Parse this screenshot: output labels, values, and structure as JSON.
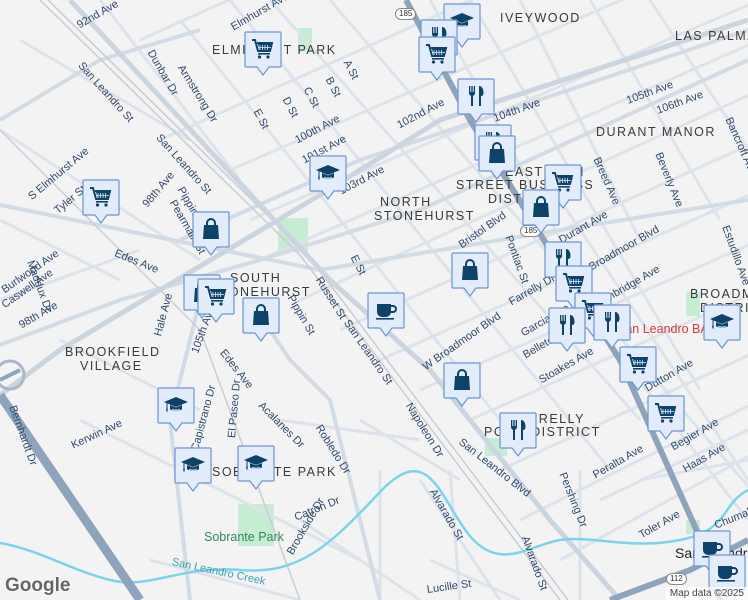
{
  "districts": {
    "elmhurst_park": "ELMHURST PARK",
    "iveywood": "IVEYWOOD",
    "las_palmas": "LAS PALMAS",
    "durant_manor": "DURANT MANOR",
    "north_stonehurst_1": "NORTH",
    "north_stonehurst_2": "STONEHURST",
    "east14_1": "EAST 14TH",
    "east14_2": "STREET BUSINESS",
    "east14_3": "DISTRICT",
    "south_stonehurst_1": "SOUTH",
    "south_stonehurst_2": "STONEHURST",
    "brookfield_1": "BROOKFIELD",
    "brookfield_2": "VILLAGE",
    "broadmoor_1": "BROADMOOR",
    "broadmoor_2": "DISTRICT",
    "farrelly_1": "FARRELLY",
    "farrelly_2": "POND DISTRICT",
    "sobrante": "SOBRANTE PARK",
    "san_leandro": "San Leandro"
  },
  "streets": {
    "s92nd": "92nd Ave",
    "elmhurst": "Elmhurst Ave",
    "dunbar": "Dunbar Dr",
    "armstrong": "Armstrong Dr",
    "ast": "A St",
    "bst": "B St",
    "cst": "C St",
    "dst": "D St",
    "est": "E St",
    "est2": "E St",
    "sls1": "San Leandro St",
    "sls2": "San Leandro St",
    "sls3": "San Leandro St",
    "a100": "100th Ave",
    "a101": "101st Ave",
    "a103": "103rd Ave",
    "a102": "102nd Ave",
    "a104": "104th Ave",
    "a105": "105th Ave",
    "a106": "106th Ave",
    "a105b": "105th Ave",
    "selmhurst": "S Elmhurst Ave",
    "tyler": "Tyler St",
    "a98": "98th Ave",
    "a98b": "98th Ave",
    "pippin": "Pippin St",
    "pippin2": "Pippin St",
    "pearmain": "Pearmain St",
    "edes": "Edes Ave",
    "edes2": "Edes Ave",
    "maddux": "Maddux Dr",
    "caswell": "Caswell Ave",
    "burlwood": "Burlwood Ave",
    "hale": "Hale Ave",
    "russet": "Russet St",
    "breed": "Breed Ave",
    "beverly": "Beverly Ave",
    "bancroft": "Bancroft Ave",
    "bristol": "Bristol Blvd",
    "pontiac": "Pontiac St",
    "durant": "Durant Ave",
    "broadmoor": "Broadmoor Blvd",
    "wbroadmoor": "W Broadmoor Blvd",
    "farrelly": "Farrelly Dr",
    "garcia": "Garcia Ave",
    "belleterre": "Belleterre Ave",
    "stoakes": "Stoakes Ave",
    "dutton": "Dutton Ave",
    "begier": "Begier Ave",
    "haas": "Haas Ave",
    "peralta": "Peralta Ave",
    "toler": "Toler Ave",
    "chumalia": "Chumalia St",
    "pershing": "Pershing Dr",
    "napoleon": "Napoleon Dr",
    "slblvd": "San Leandro Blvd",
    "alvarado": "Alvarado St",
    "alvarado2": "Alvarado St",
    "lucille": "Lucille St",
    "bernhardt": "Bernhardt Dr",
    "kerwin": "Kerwin Ave",
    "capistrano": "Capistrano Dr",
    "elpaseo": "El Paseo Dr",
    "acalanes": "Acalanes Dr",
    "robledo": "Robledo Dr",
    "catron": "Catron Dr",
    "brookside": "Brookside Dr",
    "cambridge": "Cambridge Ave",
    "estudillo": "Estudillo Ave"
  },
  "parks": {
    "sobrante_park": "Sobrante Park"
  },
  "water": {
    "creek": "San Leandro Creek"
  },
  "poi": {
    "san_leandro_bart": "San Leandro BART"
  },
  "shields": {
    "hwy185a": "185",
    "hwy185b": "185",
    "hwy112": "112"
  },
  "footer": {
    "logo": "Google",
    "attribution": "Map data ©2025"
  },
  "colors": {
    "marker_fill": "#e3ecfb",
    "marker_border": "#6b94d6",
    "icon": "#0d4369",
    "highway": "#8fa3bb",
    "road": "#d5dde6",
    "creek": "#7ad4ea",
    "park": "#c6ecd4"
  }
}
